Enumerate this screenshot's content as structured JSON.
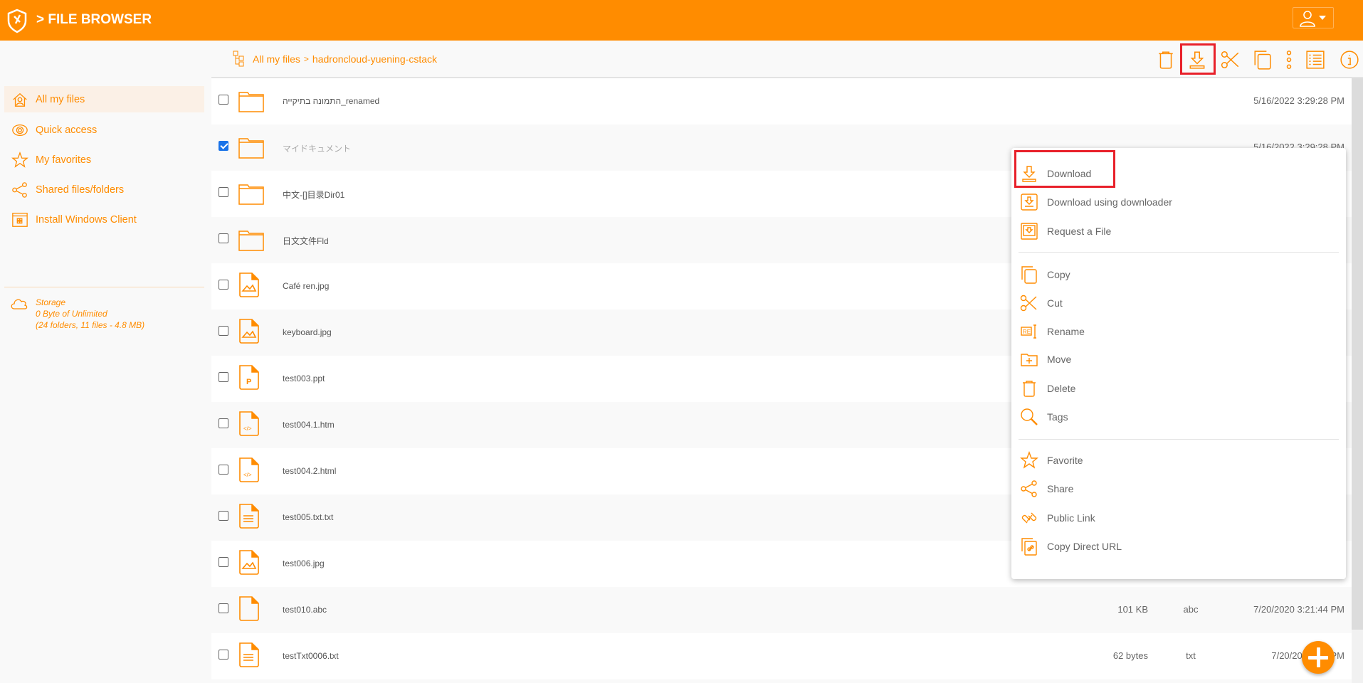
{
  "header": {
    "title": "> FILE BROWSER",
    "brand_color": "#ff8c00",
    "user_icon": "user-icon"
  },
  "sidebar": {
    "search_icon": "search-icon",
    "items": [
      {
        "label": "All my files",
        "icon": "home-icon",
        "active": true
      },
      {
        "label": "Quick access",
        "icon": "eye-icon"
      },
      {
        "label": "My favorites",
        "icon": "star-icon"
      },
      {
        "label": "Shared files/folders",
        "icon": "share-icon"
      },
      {
        "label": "Install Windows Client",
        "icon": "windows-client-icon"
      }
    ],
    "storage": {
      "title": "Storage",
      "usage": "0 Byte of Unlimited",
      "details": "(24 folders, 11 files - 4.8 MB)"
    }
  },
  "breadcrumb": {
    "root": "All my files",
    "separator": ">",
    "current": "hadroncloud-yuening-cstack"
  },
  "toolbar": {
    "buttons": [
      "delete",
      "download",
      "cut",
      "copy",
      "more",
      "list-view",
      "info"
    ],
    "highlighted": "download",
    "highlight_color": "#e8202a"
  },
  "files": [
    {
      "name": "התמונה בתיקייה_renamed",
      "type": "folder",
      "size": "",
      "ext": "",
      "date": "5/16/2022 3:29:28 PM",
      "checked": false
    },
    {
      "name": "マイドキュメント",
      "type": "folder",
      "size": "",
      "ext": "",
      "date": "5/16/2022 3:29:28 PM",
      "checked": true
    },
    {
      "name": "中文-[]目录Dir01",
      "type": "folder",
      "size": "",
      "ext": "",
      "date": "",
      "checked": false
    },
    {
      "name": "日文文件Fld",
      "type": "folder",
      "size": "",
      "ext": "",
      "date": "",
      "checked": false
    },
    {
      "name": "Café ren.jpg",
      "type": "image",
      "size": "",
      "ext": "",
      "date": "",
      "checked": false
    },
    {
      "name": "keyboard.jpg",
      "type": "image",
      "size": "",
      "ext": "",
      "date": "",
      "checked": false
    },
    {
      "name": "test003.ppt",
      "type": "ppt",
      "size": "",
      "ext": "",
      "date": "",
      "checked": false
    },
    {
      "name": "test004.1.htm",
      "type": "html",
      "size": "",
      "ext": "",
      "date": "",
      "checked": false
    },
    {
      "name": "test004.2.html",
      "type": "html",
      "size": "",
      "ext": "",
      "date": "",
      "checked": false
    },
    {
      "name": "test005.txt.txt",
      "type": "text",
      "size": "",
      "ext": "",
      "date": "",
      "checked": false
    },
    {
      "name": "test006.jpg",
      "type": "image",
      "size": "",
      "ext": "",
      "date": "",
      "checked": false
    },
    {
      "name": "test010.abc",
      "type": "blank",
      "size": "101 KB",
      "ext": "abc",
      "date": "7/20/2020 3:21:44 PM",
      "checked": false
    },
    {
      "name": "testTxt0006.txt",
      "type": "text",
      "size": "62 bytes",
      "ext": "txt",
      "date": "7/20/2020 6:0 PM",
      "checked": false
    }
  ],
  "context_menu": {
    "groups": [
      [
        {
          "label": "Download",
          "icon": "download-icon",
          "highlighted": true
        },
        {
          "label": "Download using downloader",
          "icon": "downloader-icon"
        },
        {
          "label": "Request a File",
          "icon": "request-file-icon"
        }
      ],
      [
        {
          "label": "Copy",
          "icon": "copy-icon"
        },
        {
          "label": "Cut",
          "icon": "scissors-icon"
        },
        {
          "label": "Rename",
          "icon": "rename-icon"
        },
        {
          "label": "Move",
          "icon": "move-icon"
        },
        {
          "label": "Delete",
          "icon": "trash-icon"
        },
        {
          "label": "Tags",
          "icon": "tag-search-icon"
        }
      ],
      [
        {
          "label": "Favorite",
          "icon": "star-icon"
        },
        {
          "label": "Share",
          "icon": "share-icon"
        },
        {
          "label": "Public Link",
          "icon": "link-icon"
        },
        {
          "label": "Copy Direct URL",
          "icon": "copy-url-icon"
        }
      ]
    ]
  },
  "fab": {
    "icon": "plus-icon"
  }
}
